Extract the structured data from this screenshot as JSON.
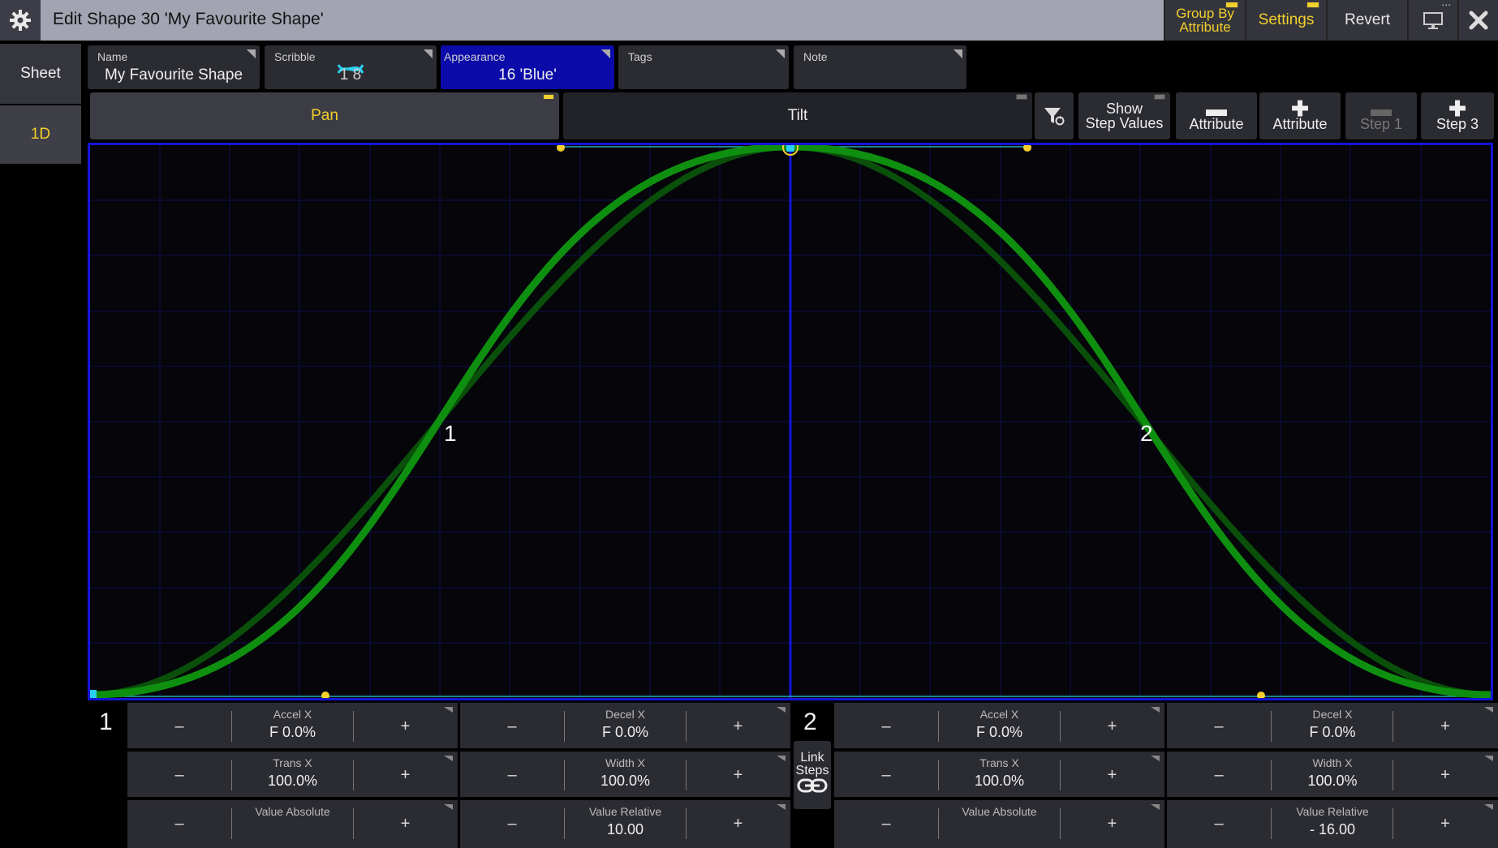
{
  "window": {
    "title": "Edit Shape 30 'My Favourite Shape'",
    "group_by_label_1": "Group By",
    "group_by_label_2": "Attribute",
    "settings_label": "Settings",
    "revert_label": "Revert"
  },
  "left_tabs": {
    "sheet": "Sheet",
    "one_d": "1D"
  },
  "props": {
    "name": {
      "label": "Name",
      "value": "My Favourite Shape"
    },
    "scribble": {
      "label": "Scribble",
      "value": "1 8"
    },
    "appearance": {
      "label": "Appearance",
      "value": "16 'Blue'"
    },
    "tags": {
      "label": "Tags",
      "value": ""
    },
    "note": {
      "label": "Note",
      "value": ""
    }
  },
  "attribute_tabs": {
    "pan": "Pan",
    "tilt": "Tilt"
  },
  "toolbar": {
    "show_step_values_1": "Show",
    "show_step_values_2": "Step Values",
    "remove_attribute": "Attribute",
    "add_attribute": "Attribute",
    "remove_step": "Step 1",
    "add_step": "Step 3"
  },
  "graph": {
    "step_label_1": "1",
    "step_label_2": "2"
  },
  "link_steps": {
    "line1": "Link",
    "line2": "Steps"
  },
  "steps": [
    {
      "number": "1",
      "accel_x": {
        "label": "Accel X",
        "value": "F  0.0%"
      },
      "decel_x": {
        "label": "Decel X",
        "value": "F  0.0%"
      },
      "trans_x": {
        "label": "Trans X",
        "value": "100.0%"
      },
      "width_x": {
        "label": "Width X",
        "value": "100.0%"
      },
      "value_absolute": {
        "label": "Value Absolute",
        "value": ""
      },
      "value_relative": {
        "label": "Value Relative",
        "value": "10.00"
      }
    },
    {
      "number": "2",
      "accel_x": {
        "label": "Accel X",
        "value": "F  0.0%"
      },
      "decel_x": {
        "label": "Decel X",
        "value": "F  0.0%"
      },
      "trans_x": {
        "label": "Trans X",
        "value": "100.0%"
      },
      "width_x": {
        "label": "Width X",
        "value": "100.0%"
      },
      "value_absolute": {
        "label": "Value Absolute",
        "value": ""
      },
      "value_relative": {
        "label": "Value Relative",
        "value": "- 16.00"
      }
    }
  ],
  "stepper": {
    "minus": "–",
    "plus": "+"
  },
  "colors": {
    "accent_yellow": "#f2cf2c",
    "curve_green": "#0f8f0f",
    "grid_blue": "#1414d8",
    "appearance_blue": "#0b0baa"
  }
}
